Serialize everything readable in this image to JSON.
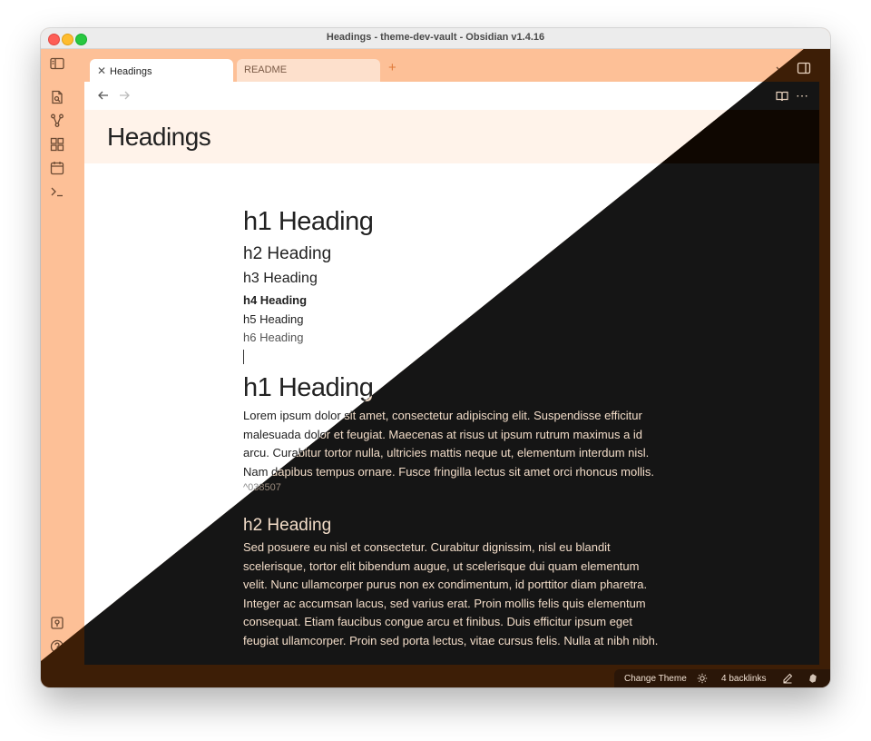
{
  "window": {
    "title": "Headings - theme-dev-vault - Obsidian v1.4.16"
  },
  "tabs": [
    {
      "label": "Headings",
      "active": true
    },
    {
      "label": "README",
      "active": false
    }
  ],
  "note": {
    "inline_title": "Headings",
    "headings": [
      "h1 Heading",
      "h2 Heading",
      "h3 Heading",
      "h4 Heading",
      "h5 Heading",
      "h6 Heading"
    ],
    "section1_title": "h1 Heading",
    "section1_lines": [
      "Lorem ipsum dolor sit amet, consectetur adipiscing elit. Suspendisse efficitur",
      "malesuada dolor et feugiat. Maecenas at risus ut ipsum rutrum maximus a id",
      "arcu. Curabitur tortor nulla, ultricies mattis neque ut, elementum interdum nisl.",
      "Nam dapibus tempus ornare. Fusce fringilla lectus sit amet orci rhoncus mollis."
    ],
    "block_id": "^038507",
    "section2_title": "h2 Heading",
    "section2_lines": [
      "Sed posuere eu nisl et consectetur. Curabitur dignissim, nisl eu blandit",
      "scelerisque, tortor elit bibendum augue, ut scelerisque dui quam elementum",
      "velit. Nunc ullamcorper purus non ex condimentum, id porttitor diam pharetra.",
      "Integer ac accumsan lacus, sed varius erat. Proin mollis felis quis elementum",
      "consequat. Etiam faucibus congue arcu et finibus. Duis efficitur ipsum eget",
      "feugiat ullamcorper. Proin sed porta lectus, vitae cursus felis. Nulla at nibh nibh."
    ]
  },
  "statusbar": {
    "theme_label": "Change Theme",
    "backlinks": "4 backlinks"
  },
  "colors": {
    "light_accent": "#fdc097",
    "dark_bg": "#151515",
    "dark_chrome": "#3d1e06"
  }
}
